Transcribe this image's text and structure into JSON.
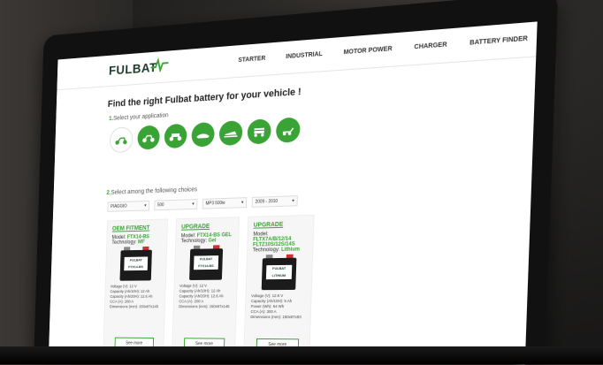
{
  "nav": {
    "logo": "FULBAT",
    "links": [
      "STARTER",
      "INDUSTRIAL",
      "MOTOR POWER",
      "CHARGER",
      "BATTERY FINDER"
    ]
  },
  "main": {
    "title": "Find the right Fulbat battery for your vehicle !",
    "step1": {
      "num": "1.",
      "label": "Select your application"
    },
    "step2": {
      "num": "2.",
      "label": "Select among the following choices"
    },
    "selects": [
      "PIAGGIO",
      "500",
      "MP3 500ie",
      "2009 - 2010"
    ],
    "cards": [
      {
        "tag": "OEM FITMENT",
        "model_label": "Model:",
        "model": "FTX14-BS",
        "tech_label": "Technology:",
        "tech": "MF",
        "battery_label": "FULBAT FTX14-BS",
        "specs": [
          "Voltage (V): 12 V",
          "Capacity (Ah/10H): 12 Ah",
          "Capacity (Ah/20H): 12.6 Ah",
          "CCA (A): 200 A",
          "Dimensions (mm): 150x87x145"
        ],
        "button": "See more"
      },
      {
        "tag": "UPGRADE",
        "model_label": "Model:",
        "model": "FTX14-BS GEL",
        "tech_label": "Technology:",
        "tech": "Gel",
        "battery_label": "FULBAT FTX14-BS",
        "specs": [
          "Voltage (V): 12 V",
          "Capacity (Ah/10H): 12 Ah",
          "Capacity (Ah/20H): 12.6 Ah",
          "CCA (A): 200 A",
          "Dimensions (mm): 150x87x145"
        ],
        "button": "See more"
      },
      {
        "tag": "UPGRADE",
        "model_label": "Model:",
        "model": "FLTX7A/B/12/14 FLTZ10S/12S/14S",
        "tech_label": "Technology:",
        "tech": "Lithium",
        "battery_label": "FULBAT LITHIUM",
        "specs": [
          "Voltage (V): 12.8 V",
          "Capacity (Ah/10H): 5 Ah",
          "Power (Wh): 64 Wh",
          "CCA (A): 300 A",
          "Dimensions (mm): 150x87x93"
        ],
        "button": "See more"
      }
    ]
  },
  "colors": {
    "accent": "#3aa335",
    "logo": "#1d3b2a"
  },
  "icons": [
    "scooter-icon",
    "motorbike-icon",
    "atv-icon",
    "jetski-icon",
    "snowmobile-icon",
    "golf-cart-icon",
    "lawnmower-icon"
  ]
}
